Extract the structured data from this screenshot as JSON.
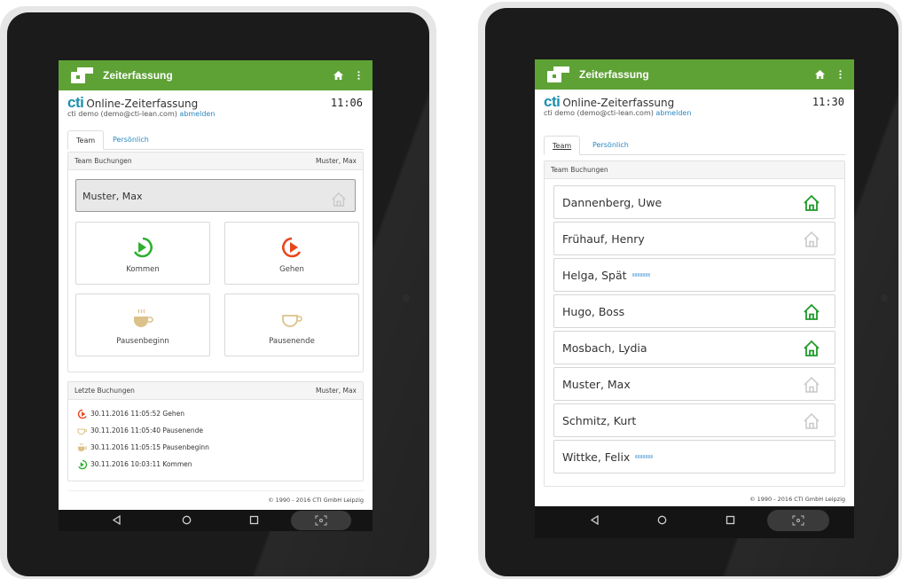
{
  "app_title": "Zeiterfassung",
  "brand": {
    "logo": "cti",
    "title": "Online-Zeiterfassung"
  },
  "user": {
    "text": "cti demo (demo@cti-lean.com)",
    "logout": "abmelden"
  },
  "tabs": [
    "Team",
    "Persönlich"
  ],
  "footer": "© 1990 - 2016 CTI GmbH Leipzig",
  "tablets": [
    {
      "time": "11:06",
      "team_panel": {
        "title": "Team Buchungen",
        "selected": "Muster, Max"
      },
      "selected_person": "Muster, Max",
      "actions": [
        {
          "label": "Kommen",
          "icon": "kommen-icon"
        },
        {
          "label": "Gehen",
          "icon": "gehen-icon"
        },
        {
          "label": "Pausenbeginn",
          "icon": "pausenbeginn-icon"
        },
        {
          "label": "Pausenende",
          "icon": "pausenende-icon"
        }
      ],
      "recent": {
        "title": "Letzte Buchungen",
        "person": "Muster, Max",
        "items": [
          {
            "text": "30.11.2016 11:05:52 Gehen",
            "icon": "gehen-icon"
          },
          {
            "text": "30.11.2016 11:05:40 Pausenende",
            "icon": "pausenende-icon"
          },
          {
            "text": "30.11.2016 11:05:15 Pausenbeginn",
            "icon": "pausenbeginn-icon"
          },
          {
            "text": "30.11.2016 10:03:11 Kommen",
            "icon": "kommen-icon"
          }
        ]
      }
    },
    {
      "time": "11:30",
      "team_panel": {
        "title": "Team Buchungen"
      },
      "persons": [
        {
          "name": "Dannenberg, Uwe",
          "status": "present"
        },
        {
          "name": "Frühauf, Henry",
          "status": "absent"
        },
        {
          "name": "Helga, Spät",
          "status": "pause"
        },
        {
          "name": "Hugo, Boss",
          "status": "present"
        },
        {
          "name": "Mosbach, Lydia",
          "status": "present"
        },
        {
          "name": "Muster, Max",
          "status": "absent"
        },
        {
          "name": "Schmitz, Kurt",
          "status": "absent"
        },
        {
          "name": "Wittke, Felix",
          "status": "pause"
        }
      ]
    }
  ],
  "colors": {
    "appbar": "#5ea236",
    "brand": "#1b8fb0",
    "link": "#2a87c0",
    "kommen": "#2fb02f",
    "gehen": "#e8461b",
    "pause": "#dcc28a",
    "present": "#1f9a2a",
    "absent": "#c8c8c8"
  }
}
